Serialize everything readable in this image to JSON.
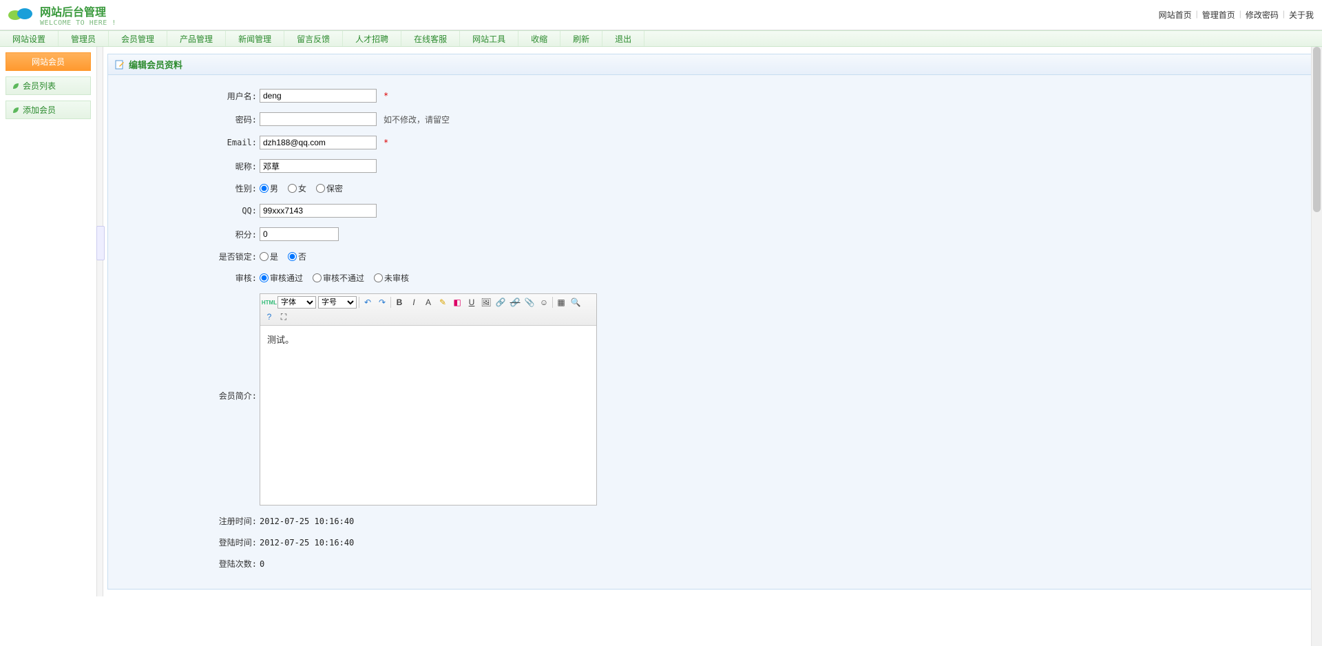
{
  "header": {
    "title": "网站后台管理",
    "subtitle": "WELCOME TO HERE !",
    "links": [
      "网站首页",
      "管理首页",
      "修改密码",
      "关于我"
    ]
  },
  "nav": [
    "网站设置",
    "管理员",
    "会员管理",
    "产品管理",
    "新闻管理",
    "留言反馈",
    "人才招聘",
    "在线客服",
    "网站工具",
    "收缩",
    "刷新",
    "退出"
  ],
  "sidebar": {
    "title": "网站会员",
    "items": [
      "会员列表",
      "添加会员"
    ]
  },
  "panel": {
    "title": "编辑会员资料"
  },
  "form": {
    "username": {
      "label": "用户名:",
      "value": "deng"
    },
    "password": {
      "label": "密码:",
      "value": "",
      "hint": "如不修改，请留空"
    },
    "email": {
      "label": "Email:",
      "value": "dzh188@qq.com"
    },
    "nickname": {
      "label": "昵称:",
      "value": "邓草"
    },
    "gender": {
      "label": "性别:",
      "opts": [
        "男",
        "女",
        "保密"
      ]
    },
    "qq": {
      "label": "QQ:",
      "value": "99xxx7143"
    },
    "points": {
      "label": "积分:",
      "value": "0"
    },
    "locked": {
      "label": "是否锁定:",
      "opts": [
        "是",
        "否"
      ]
    },
    "audit": {
      "label": "审核:",
      "opts": [
        "审核通过",
        "审核不通过",
        "未审核"
      ]
    },
    "intro": {
      "label": "会员简介:",
      "content": "测试。"
    },
    "reg": {
      "label": "注册时间:",
      "value": "2012-07-25 10:16:40"
    },
    "login": {
      "label": "登陆时间:",
      "value": "2012-07-25 10:16:40"
    },
    "count": {
      "label": "登陆次数:",
      "value": "0"
    }
  },
  "editor": {
    "font_ph": "字体",
    "size_ph": "字号"
  },
  "required": "*"
}
